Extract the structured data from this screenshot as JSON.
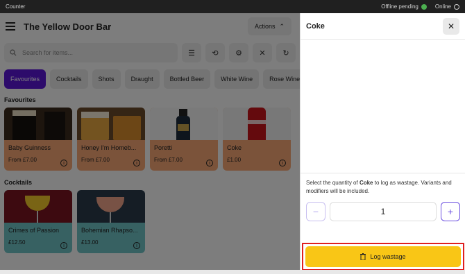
{
  "statusbar": {
    "app_label": "Counter",
    "sync": "Offline pending",
    "connection": "Online"
  },
  "header": {
    "venue": "The Yellow Door Bar",
    "actions_label": "Actions"
  },
  "search": {
    "placeholder": "Search for items..."
  },
  "toolbar_icons": [
    "filter-icon",
    "history-icon",
    "settings-icon",
    "utensils-icon",
    "refresh-icon"
  ],
  "categories": [
    {
      "label": "Favourites",
      "active": true
    },
    {
      "label": "Cocktails"
    },
    {
      "label": "Shots"
    },
    {
      "label": "Draught"
    },
    {
      "label": "Bottled Beer"
    },
    {
      "label": "White Wine"
    },
    {
      "label": "Rose Wine"
    }
  ],
  "sections": {
    "favourites": {
      "title": "Favourites",
      "items": [
        {
          "name": "Baby Guinness",
          "price": "From £7.00"
        },
        {
          "name": "Honey I'm Homeb...",
          "price": "From £7.00"
        },
        {
          "name": "Poretti",
          "price": "From £7.00"
        },
        {
          "name": "Coke",
          "price": "£1.00"
        }
      ]
    },
    "cocktails": {
      "title": "Cocktails",
      "items": [
        {
          "name": "Crimes of Passion",
          "price": "£12.50"
        },
        {
          "name": "Bohemian Rhapso...",
          "price": "£13.00"
        }
      ]
    }
  },
  "panel": {
    "title": "Coke",
    "instruction_prefix": "Select the quantity of ",
    "instruction_item": "Coke",
    "instruction_suffix": " to log as wastage. Variants and modifiers will be included.",
    "quantity": "1",
    "minus": "−",
    "plus": "+",
    "log_label": "Log wastage"
  },
  "colors": {
    "accent": "#5b17d6",
    "log_button": "#f9c616",
    "card_orange": "#f7a774",
    "card_teal": "#6fc2c5",
    "highlight": "#e02020"
  }
}
